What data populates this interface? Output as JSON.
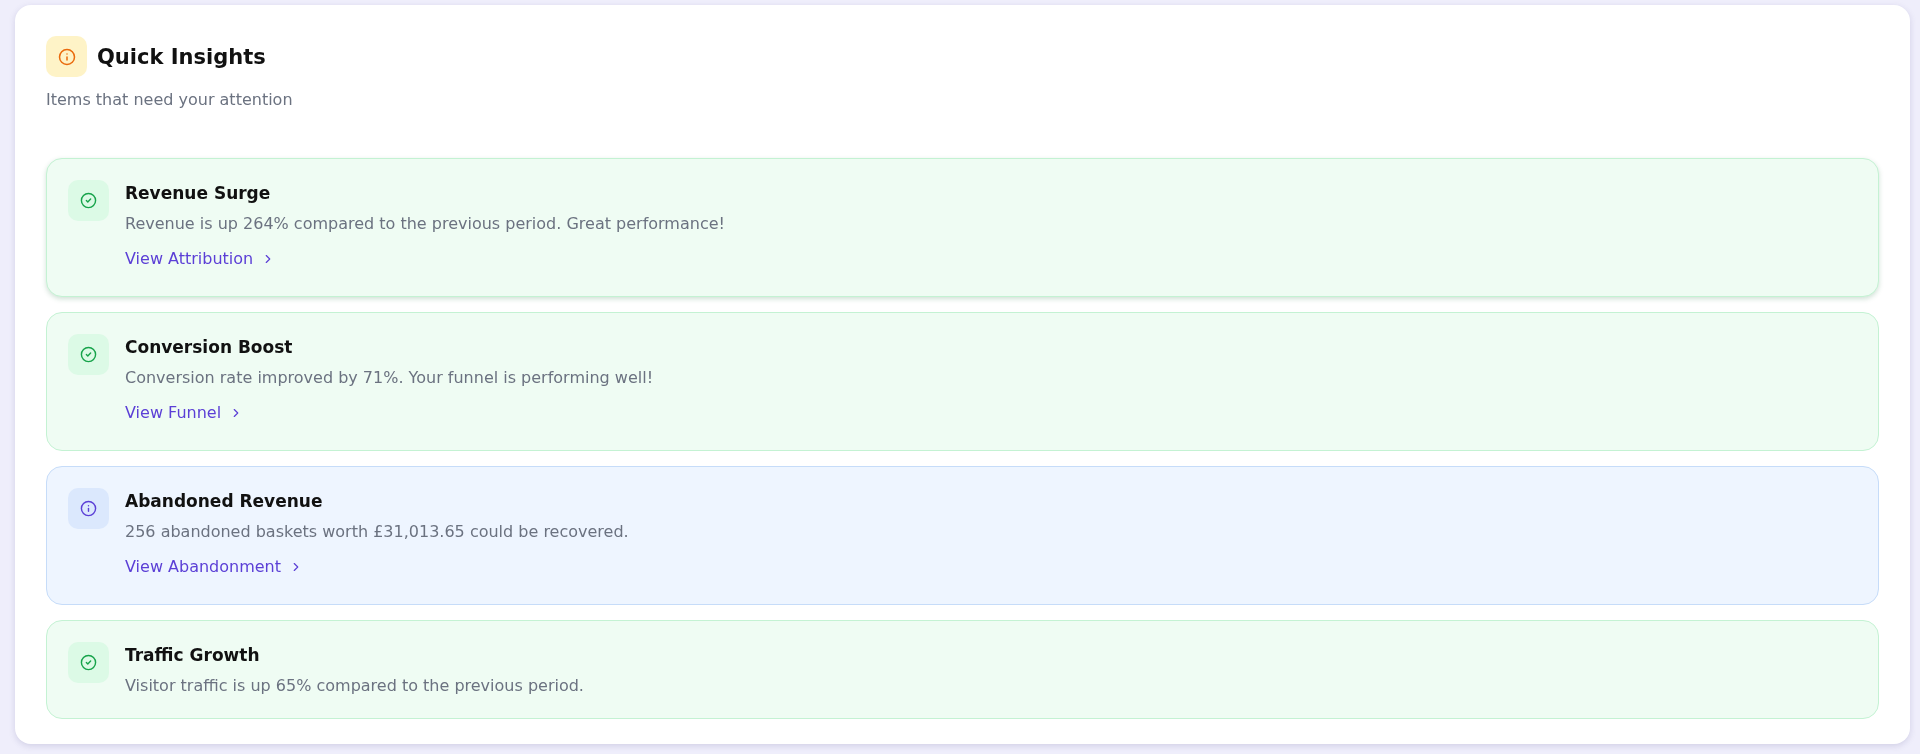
{
  "header": {
    "title": "Quick Insights",
    "subtitle": "Items that need your attention"
  },
  "insights": [
    {
      "kind": "success",
      "title": "Revenue Surge",
      "description": "Revenue is up 264% compared to the previous period. Great performance!",
      "link": "View Attribution",
      "hovered": true
    },
    {
      "kind": "success",
      "title": "Conversion Boost",
      "description": "Conversion rate improved by 71%. Your funnel is performing well!",
      "link": "View Funnel",
      "hovered": false
    },
    {
      "kind": "info",
      "title": "Abandoned Revenue",
      "description": "256 abandoned baskets worth £31,013.65 could be recovered.",
      "link": "View Abandonment",
      "hovered": false
    },
    {
      "kind": "success",
      "title": "Traffic Growth",
      "description": "Visitor traffic is up 65% compared to the previous period.",
      "hovered": false
    }
  ]
}
